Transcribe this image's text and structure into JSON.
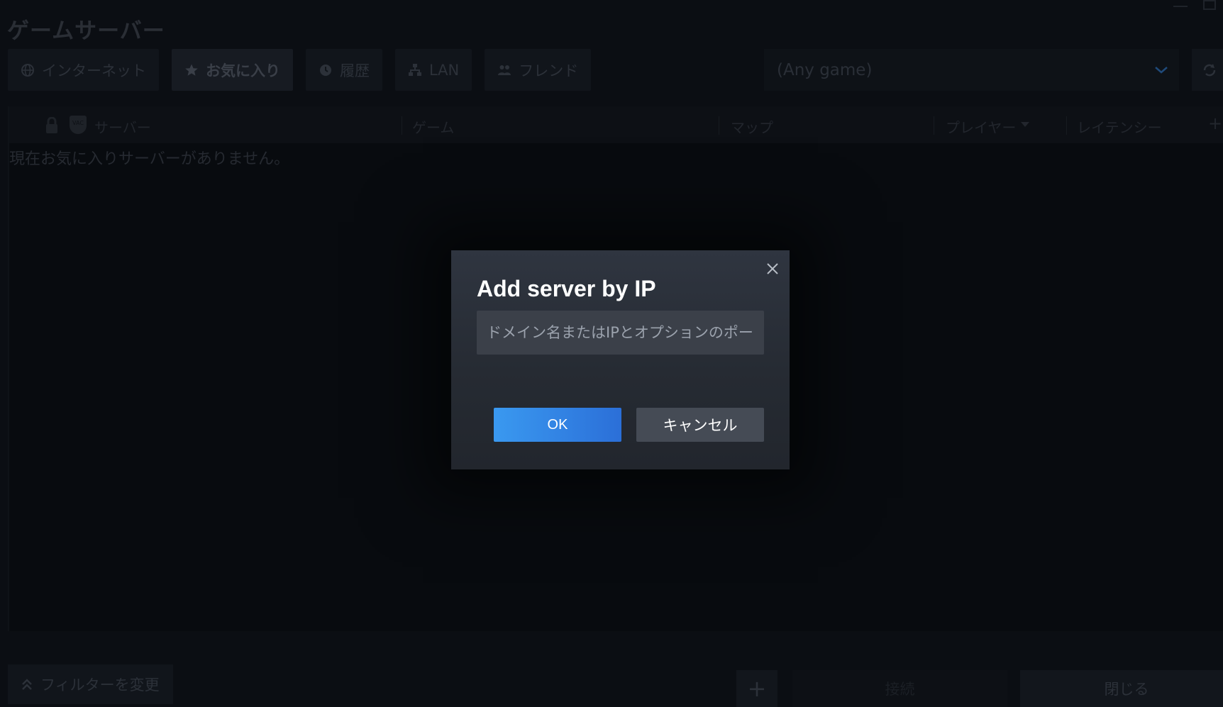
{
  "window": {
    "title": "ゲームサーバー"
  },
  "tabs": [
    {
      "label": "インターネット",
      "icon": "globe-icon"
    },
    {
      "label": "お気に入り",
      "icon": "star-icon",
      "active": true
    },
    {
      "label": "履歴",
      "icon": "clock-icon"
    },
    {
      "label": "LAN",
      "icon": "lan-icon"
    },
    {
      "label": "フレンド",
      "icon": "friends-icon"
    }
  ],
  "game_filter": {
    "selected": "(Any game)"
  },
  "table": {
    "columns": {
      "server": "サーバー",
      "game": "ゲーム",
      "map": "マップ",
      "players": "プレイヤー",
      "latency": "レイテンシー"
    },
    "vac_label": "VAC",
    "empty_message": "現在お気に入りサーバーがありません。"
  },
  "bottom_bar": {
    "filter_label": "フィルターを変更",
    "add_label": "+",
    "connect_label": "接続",
    "close_label": "閉じる"
  },
  "dialog": {
    "title": "Add server by IP",
    "input_placeholder": "ドメイン名またはIPとオプションのポート番号",
    "input_value": "",
    "ok_label": "OK",
    "cancel_label": "キャンセル"
  },
  "colors": {
    "accent_blue": "#3a99f0",
    "dialog_bg": "#2f3540",
    "backdrop": "#0b0e13"
  }
}
